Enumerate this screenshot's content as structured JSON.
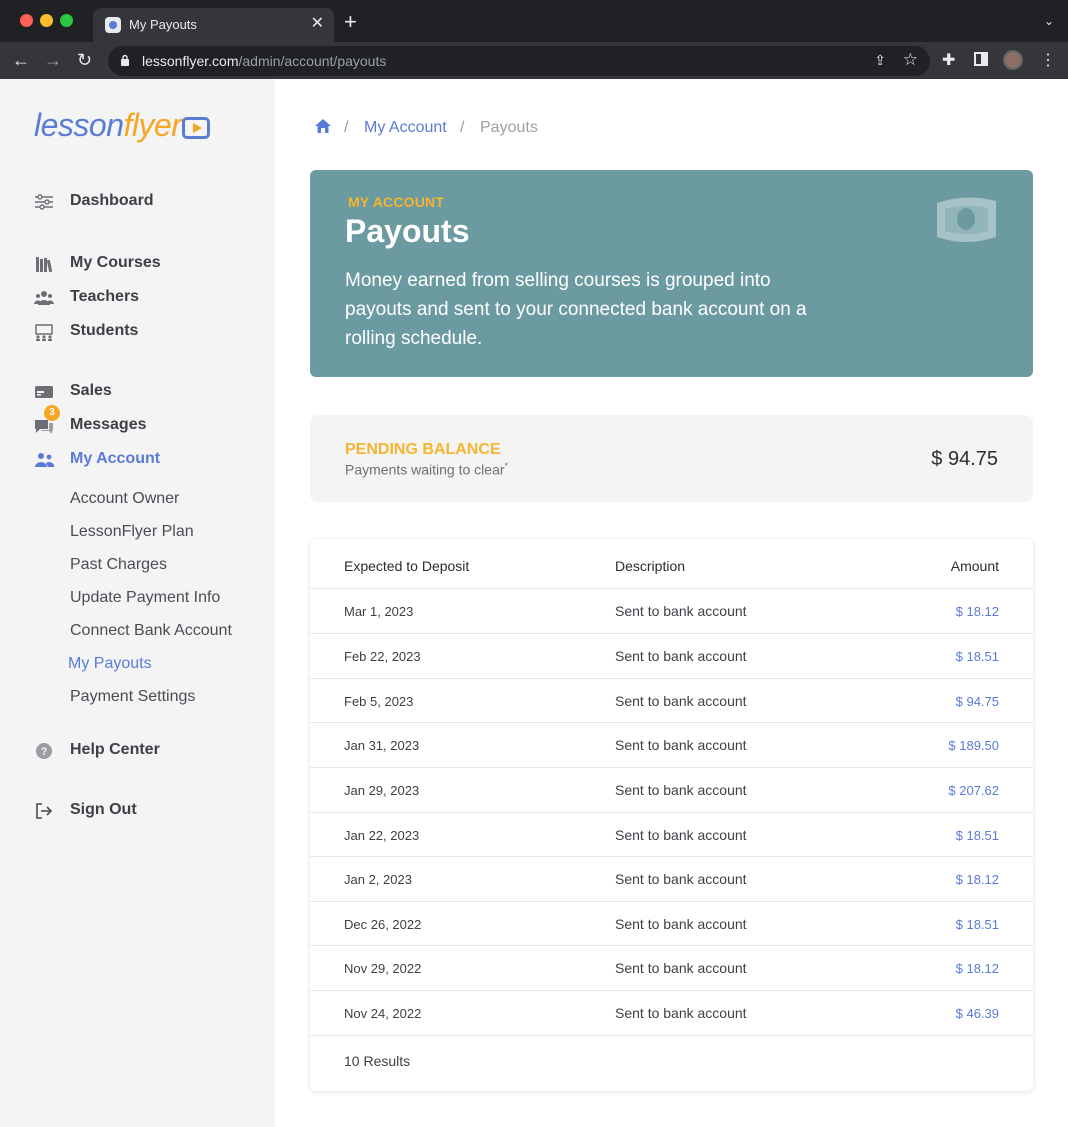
{
  "browser": {
    "tab_title": "My Payouts",
    "url_host": "lessonflyer.com",
    "url_path": "/admin/account/payouts"
  },
  "logo": {
    "part1": "lesson",
    "part2": "flyer"
  },
  "sidebar": {
    "items": [
      {
        "label": "Dashboard",
        "icon": "sliders-icon"
      },
      {
        "label": "My Courses",
        "icon": "books-icon"
      },
      {
        "label": "Teachers",
        "icon": "people-icon"
      },
      {
        "label": "Students",
        "icon": "classroom-icon"
      },
      {
        "label": "Sales",
        "icon": "card-icon"
      },
      {
        "label": "Messages",
        "icon": "chat-icon",
        "badge": "3"
      },
      {
        "label": "My Account",
        "icon": "users-icon"
      },
      {
        "label": "Help Center",
        "icon": "help-icon"
      },
      {
        "label": "Sign Out",
        "icon": "sign-out-icon"
      }
    ],
    "sub_items": [
      "Account Owner",
      "LessonFlyer Plan",
      "Past Charges",
      "Update Payment Info",
      "Connect Bank Account",
      "My Payouts",
      "Payment Settings"
    ]
  },
  "breadcrumb": {
    "link": "My Account",
    "current": "Payouts",
    "separator": "/"
  },
  "hero": {
    "eyebrow": "MY ACCOUNT",
    "title": "Payouts",
    "description": "Money earned from selling courses is grouped into payouts and sent to your connected bank account on a rolling schedule."
  },
  "balance": {
    "label": "PENDING BALANCE",
    "sub": "Payments waiting to clear",
    "sub_mark": "*",
    "amount": "$ 94.75"
  },
  "table": {
    "headers": {
      "date": "Expected to Deposit",
      "description": "Description",
      "amount": "Amount"
    },
    "rows": [
      {
        "date": "Mar 1, 2023",
        "description": "Sent to bank account",
        "amount": "$ 18.12"
      },
      {
        "date": "Feb 22, 2023",
        "description": "Sent to bank account",
        "amount": "$ 18.51"
      },
      {
        "date": "Feb 5, 2023",
        "description": "Sent to bank account",
        "amount": "$ 94.75"
      },
      {
        "date": "Jan 31, 2023",
        "description": "Sent to bank account",
        "amount": "$ 189.50"
      },
      {
        "date": "Jan 29, 2023",
        "description": "Sent to bank account",
        "amount": "$ 207.62"
      },
      {
        "date": "Jan 22, 2023",
        "description": "Sent to bank account",
        "amount": "$ 18.51"
      },
      {
        "date": "Jan 2, 2023",
        "description": "Sent to bank account",
        "amount": "$ 18.12"
      },
      {
        "date": "Dec 26, 2022",
        "description": "Sent to bank account",
        "amount": "$ 18.51"
      },
      {
        "date": "Nov 29, 2022",
        "description": "Sent to bank account",
        "amount": "$ 18.12"
      },
      {
        "date": "Nov 24, 2022",
        "description": "Sent to bank account",
        "amount": "$ 46.39"
      }
    ],
    "results": "10 Results"
  },
  "colors": {
    "accent": "#5a7bd6",
    "highlight": "#f5b52e",
    "hero_bg": "#6b9aa1",
    "sidebar_bg": "#f4f4f5"
  }
}
